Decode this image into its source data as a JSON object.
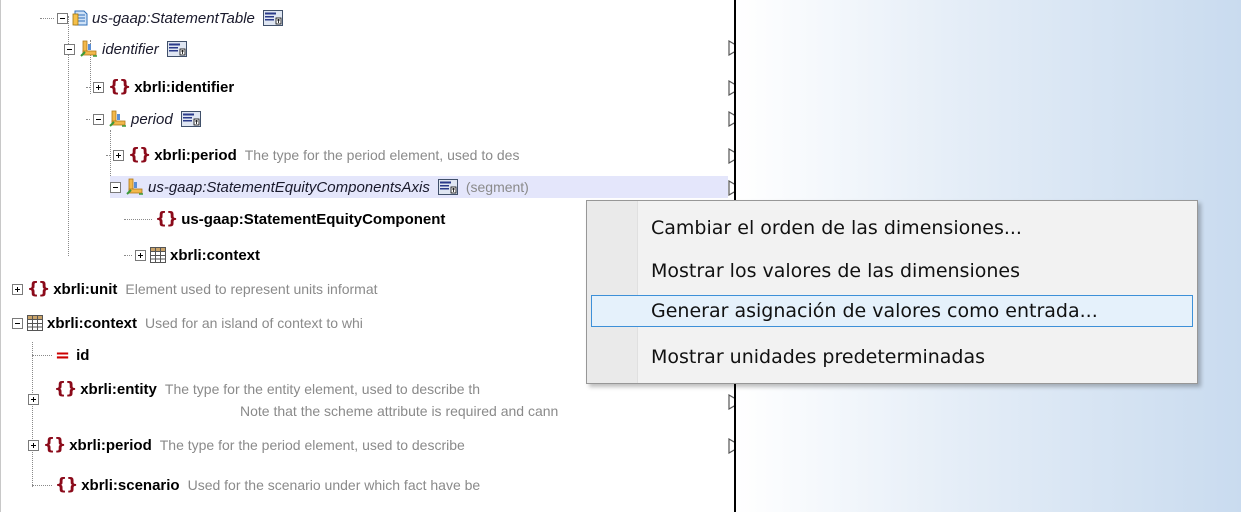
{
  "tree": {
    "rows": [
      {
        "name": "us-gaap:StatementTable"
      },
      {
        "name": "identifier"
      },
      {
        "name": "xbrli:identifier"
      },
      {
        "name": "period"
      },
      {
        "name": "xbrli:period",
        "desc": "The type for the period element, used to des"
      },
      {
        "name": "us-gaap:StatementEquityComponentsAxis",
        "segment": "(segment)"
      },
      {
        "name": "us-gaap:StatementEquityComponent"
      },
      {
        "name": "xbrli:context"
      },
      {
        "name": "xbrli:unit",
        "desc": "Element used to represent units informat"
      },
      {
        "name": "xbrli:context",
        "desc": "Used for an island of context to whi"
      },
      {
        "name": "id"
      },
      {
        "name": "xbrli:entity",
        "desc": "The type for the entity element, used to describe th",
        "desc2": "Note that the scheme attribute is required and cann"
      },
      {
        "name": "xbrli:period",
        "desc": "The type for the period element, used to describe"
      },
      {
        "name": "xbrli:scenario",
        "desc": "Used for the scenario under which fact have be"
      }
    ]
  },
  "context_menu": {
    "items": [
      {
        "label": "Cambiar el orden de las dimensiones..."
      },
      {
        "label": "Mostrar los valores de las dimensiones"
      },
      {
        "label": "Generar asignación de valores como entrada...",
        "active": true
      },
      {
        "label": "Mostrar unidades predeterminadas"
      }
    ]
  },
  "colors": {
    "element_brace": "#8b0a1a",
    "attribute_marker": "#cc0000",
    "highlight_row": "#e4e6fb",
    "menu_active_border": "#3d90d8",
    "menu_active_bg": "#e5f1fb",
    "right_pane_gradient_end": "#c9dbef"
  },
  "icons": [
    "expand-minus-icon",
    "expand-plus-icon",
    "table-icon",
    "dimension-axis-icon",
    "properties-button-icon",
    "grid-context-icon",
    "output-connector-icon"
  ]
}
